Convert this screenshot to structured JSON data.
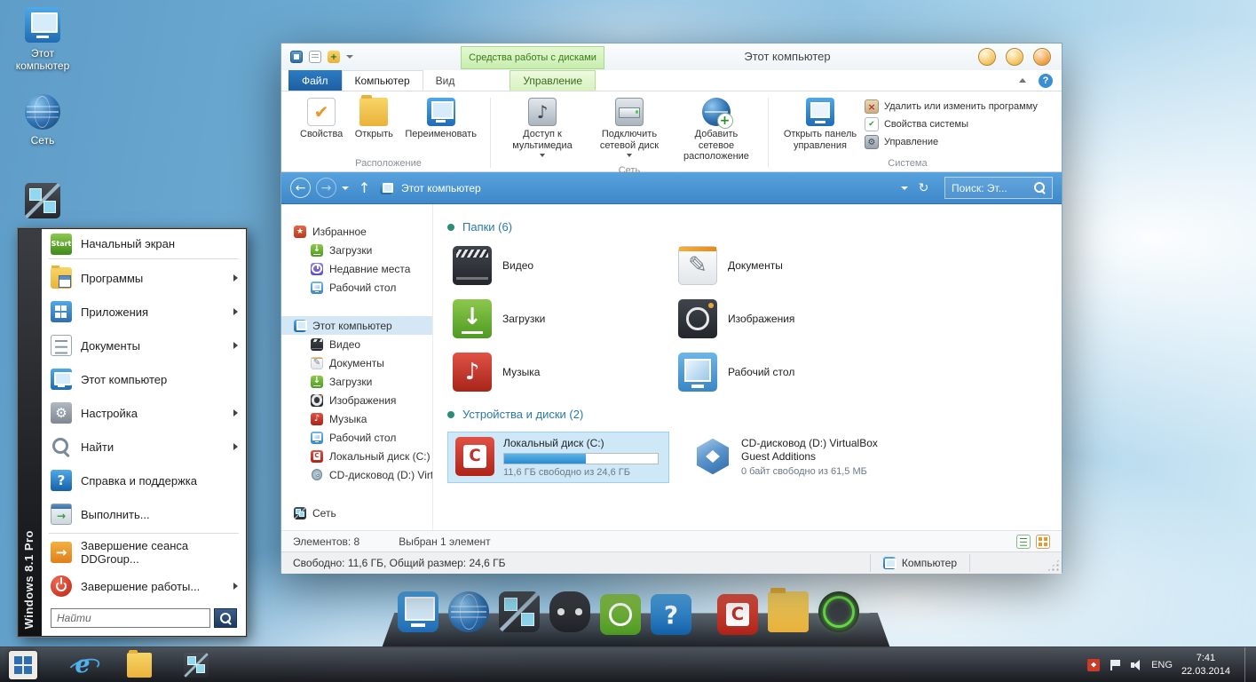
{
  "accent_colors": {
    "address_bar_blue": "#4a95d9",
    "contextual_tab_green": "#cdeebc",
    "file_tab_blue": "#1e5fa0",
    "selection_blue": "#cfe8f8",
    "drive_usage_fill": "#2a8bd0"
  },
  "desktop": {
    "icons": [
      {
        "label": "Этот компьютер",
        "icon": "computer"
      },
      {
        "label": "Сеть",
        "icon": "globe"
      },
      {
        "label": "",
        "icon": "network"
      }
    ]
  },
  "window": {
    "title": "Этот компьютер",
    "contextual_header": "Средства работы с дисками",
    "tabs": {
      "file": "Файл",
      "computer": "Компьютер",
      "view": "Вид",
      "manage": "Управление"
    },
    "ribbon": {
      "groups": [
        {
          "label": "Расположение",
          "buttons": [
            "Свойства",
            "Открыть",
            "Переименовать"
          ]
        },
        {
          "label": "Сеть",
          "buttons": [
            "Доступ к мультимедиа",
            "Подключить сетевой диск",
            "Добавить сетевое расположение"
          ]
        },
        {
          "label": "Система",
          "big_button": "Открыть панель управления",
          "buttons": [
            "Удалить или изменить программу",
            "Свойства системы",
            "Управление"
          ]
        }
      ]
    },
    "address": {
      "path": "Этот компьютер",
      "search": "Поиск: Эт..."
    },
    "nav": [
      {
        "label": "Избранное",
        "icon": "star",
        "level": 0
      },
      {
        "label": "Загрузки",
        "icon": "downloads",
        "level": 1
      },
      {
        "label": "Недавние места",
        "icon": "recent",
        "level": 1
      },
      {
        "label": "Рабочий стол",
        "icon": "desktop",
        "level": 1
      },
      {
        "label": "Этот компьютер",
        "icon": "computer",
        "level": 0,
        "selected": true,
        "gap": true
      },
      {
        "label": "Видео",
        "icon": "video",
        "level": 1
      },
      {
        "label": "Документы",
        "icon": "documents",
        "level": 1
      },
      {
        "label": "Загрузки",
        "icon": "downloads",
        "level": 1
      },
      {
        "label": "Изображения",
        "icon": "pictures",
        "level": 1
      },
      {
        "label": "Музыка",
        "icon": "music",
        "level": 1
      },
      {
        "label": "Рабочий стол",
        "icon": "desktop",
        "level": 1
      },
      {
        "label": "Локальный диск (C:)",
        "icon": "disk-c",
        "level": 1
      },
      {
        "label": "CD-дисковод (D:) Virt",
        "icon": "cd",
        "level": 1
      },
      {
        "label": "Сеть",
        "icon": "network",
        "level": 0,
        "gap": true
      }
    ],
    "content": {
      "folders_group": {
        "title": "Папки (6)",
        "items": [
          {
            "label": "Видео",
            "icon": "video"
          },
          {
            "label": "Документы",
            "icon": "documents"
          },
          {
            "label": "Загрузки",
            "icon": "downloads"
          },
          {
            "label": "Изображения",
            "icon": "pictures"
          },
          {
            "label": "Музыка",
            "icon": "music"
          },
          {
            "label": "Рабочий стол",
            "icon": "desktop"
          }
        ]
      },
      "drives_group": {
        "title": "Устройства и диски (2)",
        "items": [
          {
            "label": "Локальный диск (C:)",
            "icon": "disk-c",
            "info": "11,6 ГБ свободно из 24,6 ГБ",
            "progress_percent": 53,
            "selected": true
          },
          {
            "label": "CD-дисковод (D:) VirtualBox Guest Additions",
            "icon": "virtualbox",
            "info": "0 байт свободно из 61,5 МБ",
            "selected": false
          }
        ]
      }
    },
    "status": {
      "items_count": "Элементов: 8",
      "selected_count": "Выбран 1 элемент",
      "disk_summary": "Свободно: 11,6 ГБ, Общий размер: 24,6 ГБ",
      "location": "Компьютер"
    }
  },
  "start_menu": {
    "brand": "Windows 8.1 Pro",
    "header": {
      "label": "Начальный экран",
      "badge": "Start"
    },
    "items": [
      {
        "label": "Программы",
        "icon": "programs",
        "arrow": true
      },
      {
        "label": "Приложения",
        "icon": "apps",
        "arrow": true
      },
      {
        "label": "Документы",
        "icon": "docs",
        "arrow": true
      },
      {
        "label": "Этот компьютер",
        "icon": "computer",
        "arrow": false
      },
      {
        "label": "Настройка",
        "icon": "settings",
        "arrow": true
      },
      {
        "label": "Найти",
        "icon": "search",
        "arrow": true
      },
      {
        "label": "Справка и поддержка",
        "icon": "help",
        "arrow": false
      },
      {
        "label": "Выполнить...",
        "icon": "run",
        "arrow": false
      }
    ],
    "footer_items": [
      {
        "label": "Завершение сеанса DDGroup...",
        "icon": "logoff",
        "arrow": false
      },
      {
        "label": "Завершение работы...",
        "icon": "shutdown",
        "arrow": true
      }
    ],
    "search_placeholder": "Найти"
  },
  "dock": {
    "items": [
      "computer",
      "globe",
      "network",
      "gamepad",
      "green-app",
      "help",
      "disk-c",
      "folder",
      "power"
    ]
  },
  "taskbar": {
    "buttons": [
      "ie",
      "folder",
      "network"
    ],
    "tray": {
      "language": "ENG",
      "time": "7:41",
      "date": "22.03.2014"
    }
  }
}
